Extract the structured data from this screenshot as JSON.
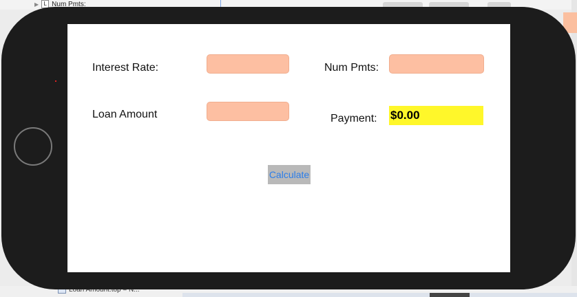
{
  "background": {
    "outline_top_label": "Num Pmts:",
    "outline_bottom_label": "Loan Amount.top = N..."
  },
  "app": {
    "interest_rate_label": "Interest Rate:",
    "num_pmts_label": "Num Pmts:",
    "loan_amount_label": "Loan Amount",
    "payment_label": "Payment:",
    "payment_value": "$0.00",
    "calculate_label": "Calculate",
    "interest_rate_value": "",
    "num_pmts_value": "",
    "loan_amount_value": ""
  },
  "colors": {
    "field_fill": "#fdbfa2",
    "payment_fill": "#fff72a",
    "button_fill": "#b9b9b9",
    "button_text": "#2b7de9",
    "device_body": "#1c1c1c"
  },
  "icons": {
    "disclosure": "disclosure-triangle-icon",
    "outline_item": "label-icon",
    "constraint": "constraint-icon"
  }
}
